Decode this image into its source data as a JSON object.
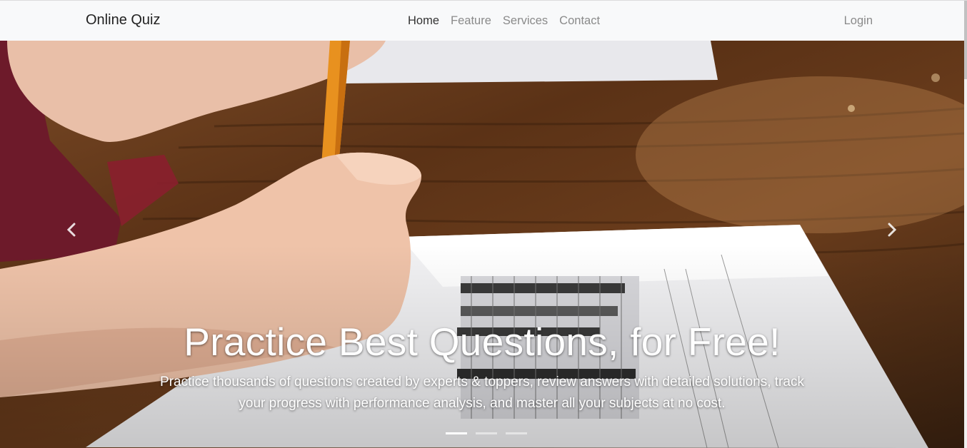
{
  "navbar": {
    "brand": "Online Quiz",
    "links": [
      {
        "label": "Home",
        "active": true
      },
      {
        "label": "Feature",
        "active": false
      },
      {
        "label": "Services",
        "active": false
      },
      {
        "label": "Contact",
        "active": false
      }
    ],
    "login_label": "Login"
  },
  "carousel": {
    "title": "Practice Best Questions, for Free!",
    "description": "Practice thousands of questions created by experts & toppers, review answers with detailed solutions, track your progress with performance analysis, and master all your subjects at no cost.",
    "indicators": [
      {
        "active": true
      },
      {
        "active": false
      },
      {
        "active": false
      }
    ],
    "prev_icon": "chevron-left-icon",
    "next_icon": "chevron-right-icon"
  },
  "colors": {
    "navbar_bg": "#f8f9fa",
    "brand_text": "#222222",
    "nav_inactive": "#8a8a8a",
    "nav_active": "#333333"
  }
}
